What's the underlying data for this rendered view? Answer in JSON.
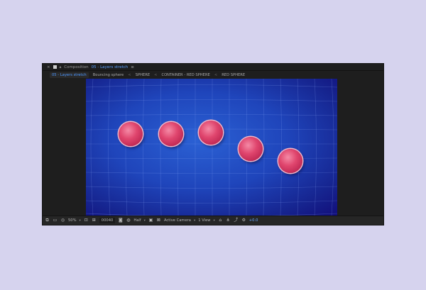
{
  "panel": {
    "title_prefix": "Composition",
    "title": "05 - Layers stretch",
    "menu_glyph": "≡",
    "close_glyph": "×"
  },
  "breadcrumb": [
    {
      "label": "05 - Layers stretch",
      "active": true
    },
    {
      "label": "Bouncing sphere",
      "active": false
    },
    {
      "label": "SPHERE",
      "active": false
    },
    {
      "label": "CONTAINER - RED SPHERE",
      "active": false
    },
    {
      "label": "RED SPHERE",
      "active": false
    }
  ],
  "breadcrumb_sep": "<",
  "viewer": {
    "bg_color": "#1f45bb",
    "ball_color": "#e0466e",
    "ball_count": 5
  },
  "toolbar": {
    "zoom": "50%",
    "timecode": "00040",
    "resolution": "Half",
    "camera": "Active Camera",
    "views": "1 View",
    "offset": "+0.0",
    "icons": [
      "layers-icon",
      "monitor-icon",
      "mask-icon",
      "region-icon",
      "transparency-icon",
      "snapshot-icon",
      "color-icon",
      "fast-preview-icon",
      "alpha-icon",
      "3d-renderer-icon",
      "flowchart-icon",
      "gear-icon"
    ]
  }
}
